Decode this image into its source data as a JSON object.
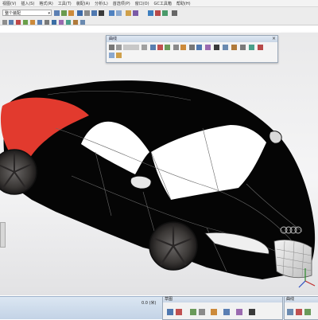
{
  "menu": {
    "items": [
      "视图(V)",
      "插入(S)",
      "格式(R)",
      "工具(T)",
      "装配(A)",
      "分析(L)",
      "首选项(P)",
      "窗口(O)",
      "GC工具箱",
      "帮助(H)"
    ]
  },
  "toolbar": {
    "filter_combo_value": "整个装配",
    "panel_right_title": "曲面"
  },
  "floating_panel": {
    "title": "曲线"
  },
  "taskbar": {
    "status_text": "0.0 (米)",
    "panel_left_title": "草图",
    "panel_right_title": "曲线"
  },
  "colors": {
    "car_body": "#050505",
    "red_panel": "#e23a2e",
    "window": "#ffffff",
    "title_bar": "#c9d6e6",
    "viewport_bg": "#eeeeef"
  }
}
